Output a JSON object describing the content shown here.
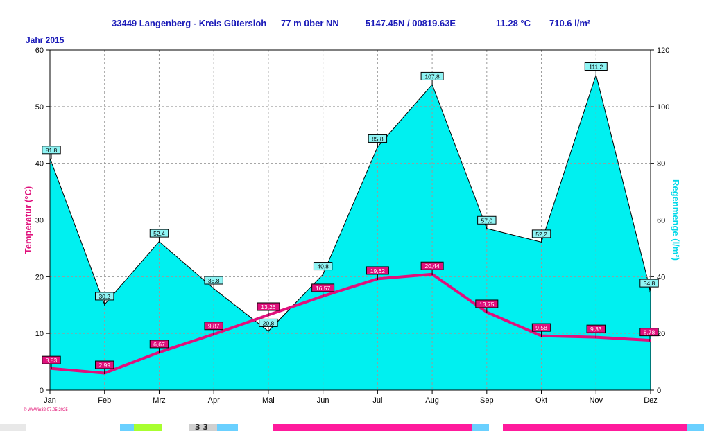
{
  "header": {
    "station": "33449 Langenberg - Kreis Gütersloh",
    "altitude": "77 m über NN",
    "coords": "5147.45N / 00819.63E",
    "mean_temp": "11.28 °C",
    "total_rain": "710.6 l/m²"
  },
  "year_label": "Jahr  2015",
  "footer_note": "© WeWin32  07.05.2025",
  "bottom_strip_text": "3 3",
  "colors": {
    "temperature": "#e0107c",
    "rain_fill": "#00f0f0",
    "rain_axis": "#00d8e8",
    "header_text": "#1a1ab8",
    "grid": "#9a9a9a"
  },
  "chart_data": {
    "type": "area",
    "categories": [
      "Jan",
      "Feb",
      "Mrz",
      "Apr",
      "Mai",
      "Jun",
      "Jul",
      "Aug",
      "Sep",
      "Okt",
      "Nov",
      "Dez"
    ],
    "series": [
      {
        "name": "Temperatur",
        "type": "line",
        "axis": "left",
        "values": [
          3.83,
          2.99,
          6.67,
          9.87,
          13.26,
          16.57,
          19.62,
          20.44,
          13.75,
          9.58,
          9.33,
          8.78
        ],
        "labels": [
          "3,83",
          "2,99",
          "6,67",
          "9,87",
          "13,26",
          "16,57",
          "19,62",
          "20,44",
          "13,75",
          "9,58",
          "9,33",
          "8,78"
        ]
      },
      {
        "name": "Regenmenge",
        "type": "area",
        "axis": "right",
        "values": [
          81.8,
          30.2,
          52.4,
          35.8,
          20.8,
          40.8,
          85.8,
          107.8,
          57.0,
          52.2,
          111.2,
          34.8
        ],
        "labels": [
          "81,8",
          "30,2",
          "52,4",
          "35,8",
          "20,8",
          "40,8",
          "85,8",
          "107,8",
          "57,0",
          "52,2",
          "111,2",
          "34,8"
        ]
      }
    ],
    "ylabel": "Temperatur  (°C)",
    "y2label": "Regenmenge   (l/m²)",
    "ylim": [
      0,
      60
    ],
    "y2lim": [
      0,
      120
    ],
    "yticks": [
      "0",
      "10",
      "20",
      "30",
      "40",
      "50",
      "60"
    ],
    "y2ticks": [
      "0",
      "20",
      "40",
      "60",
      "80",
      "100",
      "120"
    ],
    "grid": true,
    "grid_style": "dashed"
  }
}
